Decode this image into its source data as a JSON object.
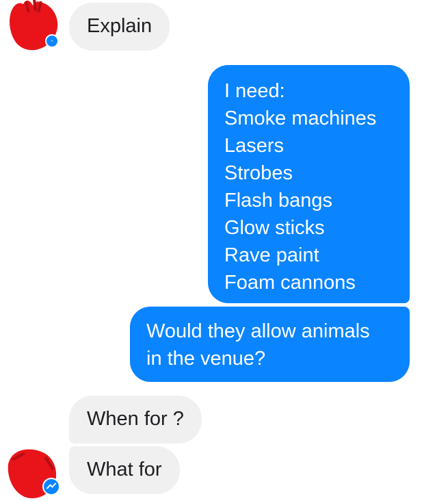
{
  "messages": [
    {
      "direction": "incoming",
      "text": "Explain"
    },
    {
      "direction": "outgoing",
      "lines": [
        "I need:",
        "Smoke machines",
        "Lasers",
        "Strobes",
        "Flash bangs",
        "Glow sticks",
        "Rave paint",
        "Foam cannons"
      ]
    },
    {
      "direction": "outgoing",
      "lines": [
        "Would they allow animals",
        "in the venue?"
      ]
    },
    {
      "direction": "incoming",
      "text": "When for ?"
    },
    {
      "direction": "incoming",
      "text": "What for"
    }
  ],
  "colors": {
    "outgoing_bubble": "#0a84ff",
    "incoming_bubble": "#f1f0f0",
    "avatar_redaction": "#e8141a",
    "messenger_badge": "#0a84ff"
  },
  "icons": {
    "avatar": "redacted-avatar",
    "badge": "messenger-icon"
  }
}
